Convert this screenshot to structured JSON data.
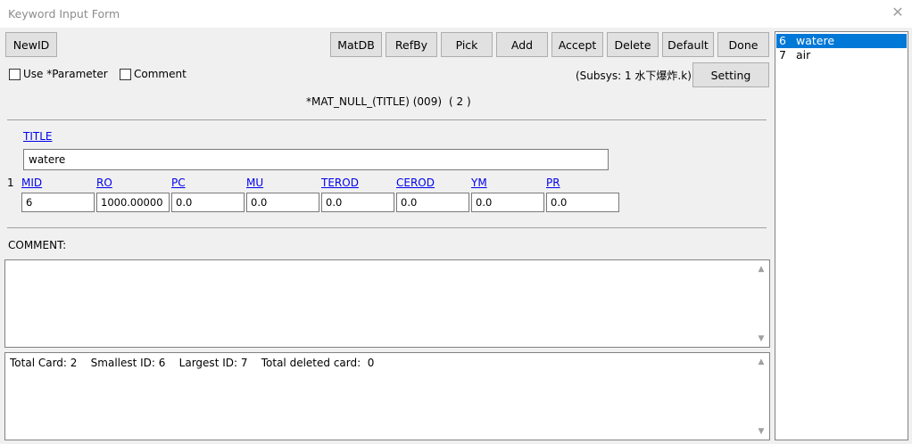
{
  "window": {
    "title": "Keyword Input Form"
  },
  "toolbar": {
    "newid": "NewID",
    "matdb": "MatDB",
    "refby": "RefBy",
    "pick": "Pick",
    "add": "Add",
    "accept": "Accept",
    "delete": "Delete",
    "default": "Default",
    "done": "Done"
  },
  "options": {
    "use_parameter": "Use *Parameter",
    "comment": "Comment",
    "subsys": "(Subsys: 1 水下爆炸.k)",
    "setting": "Setting"
  },
  "keyword": {
    "heading": "*MAT_NULL_(TITLE) (009)",
    "count": "( 2 )"
  },
  "card_title": {
    "label": "TITLE",
    "value": "watere"
  },
  "card1": {
    "row_number": "1",
    "fields": [
      {
        "label": "MID",
        "value": "6"
      },
      {
        "label": "RO",
        "value": "1000.00000"
      },
      {
        "label": "PC",
        "value": "0.0"
      },
      {
        "label": "MU",
        "value": "0.0"
      },
      {
        "label": "TEROD",
        "value": "0.0"
      },
      {
        "label": "CEROD",
        "value": "0.0"
      },
      {
        "label": "YM",
        "value": "0.0"
      },
      {
        "label": "PR",
        "value": "0.0"
      }
    ]
  },
  "comment": {
    "label": "COMMENT:",
    "value": ""
  },
  "summary": "Total Card: 2    Smallest ID: 6    Largest ID: 7    Total deleted card:  0",
  "list": {
    "items": [
      {
        "id": "6",
        "name": "watere",
        "selected": true
      },
      {
        "id": "7",
        "name": "air",
        "selected": false
      }
    ]
  },
  "colors": {
    "selection": "#0078d7",
    "link": "#0000ee"
  }
}
